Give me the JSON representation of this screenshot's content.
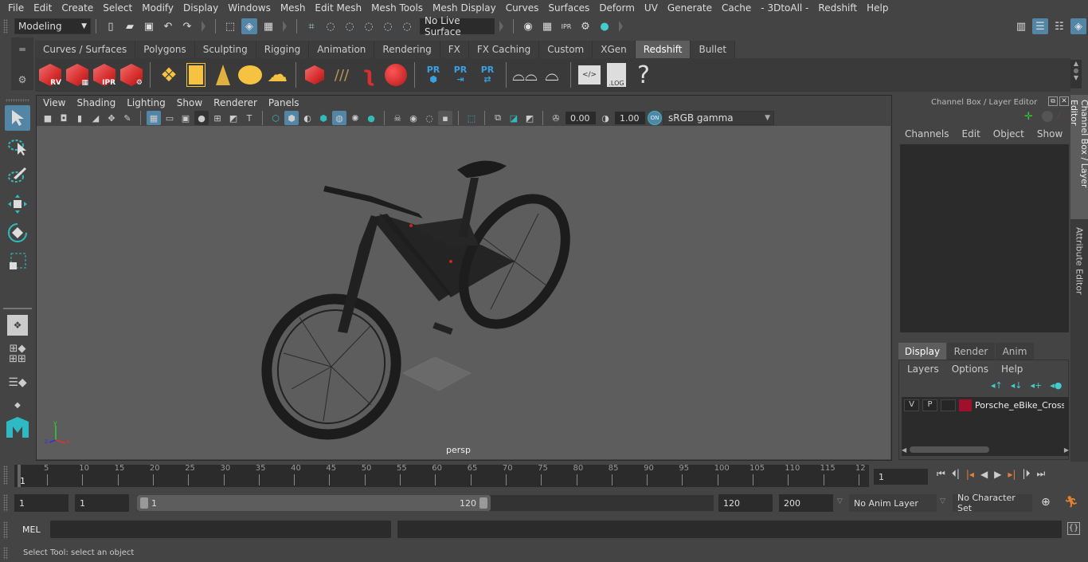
{
  "menubar": {
    "items": [
      "File",
      "Edit",
      "Create",
      "Select",
      "Modify",
      "Display",
      "Windows",
      "Mesh",
      "Edit Mesh",
      "Mesh Tools",
      "Mesh Display",
      "Curves",
      "Surfaces",
      "Deform",
      "UV",
      "Generate",
      "Cache",
      "- 3DtoAll -",
      "Redshift",
      "Help"
    ]
  },
  "statusline": {
    "mode": "Modeling",
    "live_surface": "No Live Surface"
  },
  "shelf": {
    "tabs": [
      "Curves / Surfaces",
      "Polygons",
      "Sculpting",
      "Rigging",
      "Animation",
      "Rendering",
      "FX",
      "FX Caching",
      "Custom",
      "XGen",
      "Redshift",
      "Bullet"
    ],
    "active_tab": "Redshift",
    "icons": {
      "rv": "RV",
      "ipr": "IPR",
      "pr": "PR",
      "log": ".LOG",
      "help": "?"
    }
  },
  "viewport": {
    "menu": [
      "View",
      "Shading",
      "Lighting",
      "Show",
      "Renderer",
      "Panels"
    ],
    "exposure": "0.00",
    "gamma": "1.00",
    "color_management_badge": "ON",
    "color_space": "sRGB gamma",
    "camera_label": "persp",
    "axis": {
      "x": "x",
      "y": "y",
      "z": "z"
    }
  },
  "channel_box": {
    "title": "Channel Box / Layer Editor",
    "menu": [
      "Channels",
      "Edit",
      "Object",
      "Show"
    ]
  },
  "layer_editor": {
    "tabs": [
      "Display",
      "Render",
      "Anim"
    ],
    "active_tab": "Display",
    "menu": [
      "Layers",
      "Options",
      "Help"
    ],
    "layers": [
      {
        "v": "V",
        "p": "P",
        "color": "#a0102a",
        "name": "Porsche_eBike_Cross_E"
      }
    ]
  },
  "side_tabs": [
    "Channel Box / Layer Editor",
    "Attribute Editor"
  ],
  "timeline": {
    "ticks": [
      "5",
      "10",
      "15",
      "20",
      "25",
      "30",
      "35",
      "40",
      "45",
      "50",
      "55",
      "60",
      "65",
      "70",
      "75",
      "80",
      "85",
      "90",
      "95",
      "100",
      "105",
      "110",
      "115",
      "12"
    ],
    "current_frame_marker": "1",
    "current_frame": "1"
  },
  "range": {
    "start": "1",
    "playback_start": "1",
    "slider_start": "1",
    "slider_end": "120",
    "playback_end": "120",
    "end": "200",
    "anim_layer": "No Anim Layer",
    "character_set": "No Character Set"
  },
  "command_line": {
    "language": "MEL"
  },
  "help_line": {
    "text": "Select Tool: select an object"
  }
}
